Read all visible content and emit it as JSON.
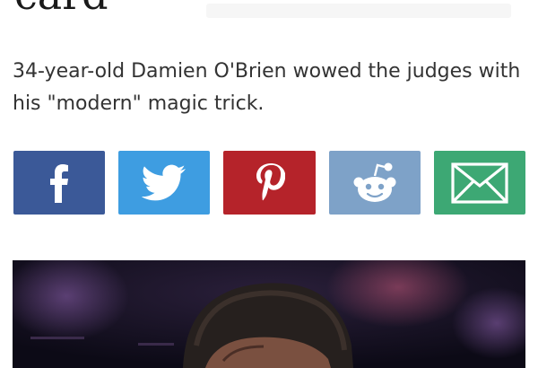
{
  "article": {
    "headline_tail": "card",
    "subheading": "34-year-old Damien O'Brien wowed the judges with his \"modern\" magic trick."
  },
  "share": {
    "buttons": [
      {
        "name": "facebook",
        "icon": "facebook-icon",
        "color": "#3b5998"
      },
      {
        "name": "twitter",
        "icon": "twitter-icon",
        "color": "#3e9de1"
      },
      {
        "name": "pinterest",
        "icon": "pinterest-icon",
        "color": "#b5232a"
      },
      {
        "name": "reddit",
        "icon": "reddit-icon",
        "color": "#7ea2c8"
      },
      {
        "name": "email",
        "icon": "email-icon",
        "color": "#3da874"
      }
    ]
  },
  "media": {
    "type": "video-still",
    "subject": "person-on-stage"
  }
}
